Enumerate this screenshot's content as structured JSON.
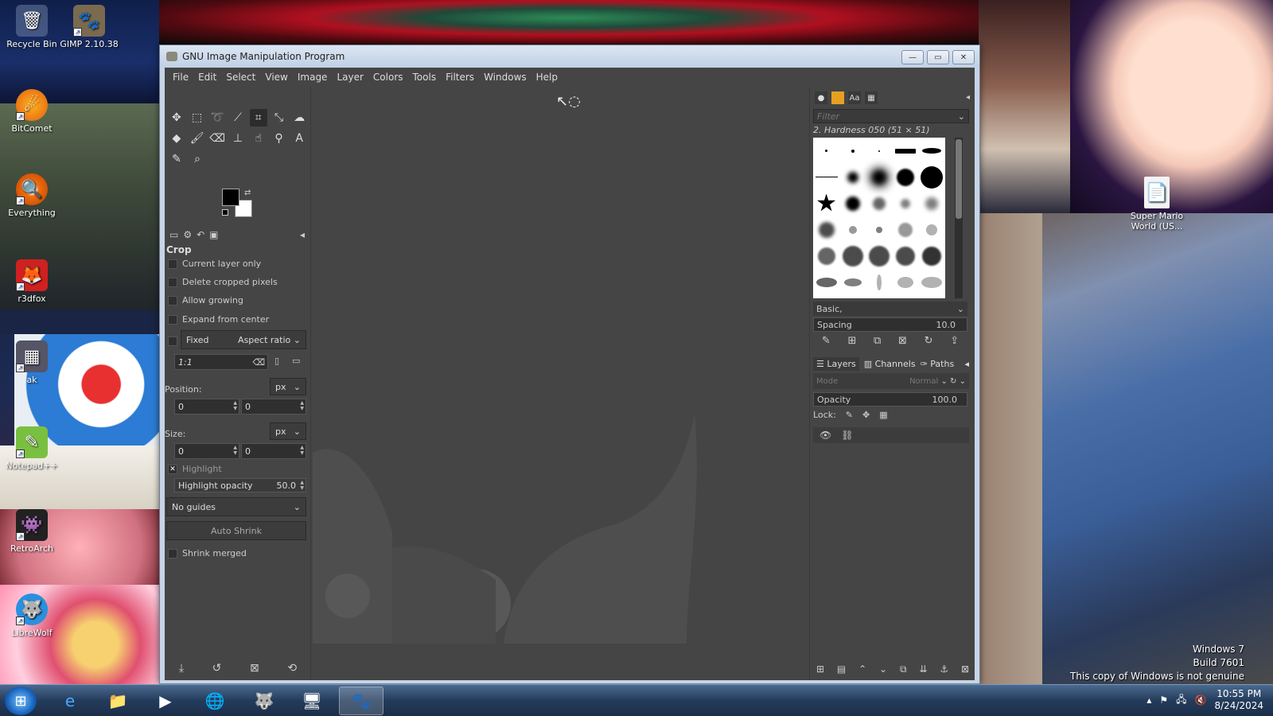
{
  "desktop": {
    "icons": [
      {
        "label": "Recycle Bin",
        "glyph": "🗑"
      },
      {
        "label": "GIMP 2.10.38",
        "glyph": "🐾"
      },
      {
        "label": "BitComet",
        "glyph": "☄"
      },
      {
        "label": "Everything",
        "glyph": "🔍"
      },
      {
        "label": "r3dfox",
        "glyph": "🦊"
      },
      {
        "label": "ak",
        "glyph": "▦"
      },
      {
        "label": "Notepad++",
        "glyph": "✎"
      },
      {
        "label": "RetroArch",
        "glyph": "👾"
      },
      {
        "label": "LibreWolf",
        "glyph": "🐺"
      },
      {
        "label": "Super Mario World (US...",
        "glyph": "📄"
      }
    ],
    "watermark": {
      "line1": "Windows 7",
      "line2": "Build 7601",
      "line3": "This copy of Windows is not genuine"
    }
  },
  "window": {
    "title": "GNU Image Manipulation Program",
    "controls": {
      "minimize": "—",
      "maximize": "▭",
      "close": "✕"
    }
  },
  "menubar": [
    "File",
    "Edit",
    "Select",
    "View",
    "Image",
    "Layer",
    "Colors",
    "Tools",
    "Filters",
    "Windows",
    "Help"
  ],
  "tool_options": {
    "title": "Crop",
    "current_layer_only": "Current layer only",
    "delete_cropped_pixels": "Delete cropped pixels",
    "allow_growing": "Allow growing",
    "expand_from_center": "Expand from center",
    "fixed_label": "Fixed",
    "fixed_mode": "Aspect ratio",
    "ratio_value": "1:1",
    "position_label": "Position:",
    "position_unit": "px",
    "position_x": "0",
    "position_y": "0",
    "size_label": "Size:",
    "size_unit": "px",
    "size_w": "0",
    "size_h": "0",
    "highlight_label": "Highlight",
    "highlight_opacity_label": "Highlight opacity",
    "highlight_opacity_value": "50.0",
    "guides": "No guides",
    "auto_shrink": "Auto Shrink",
    "shrink_merged": "Shrink merged"
  },
  "brushes": {
    "filter_placeholder": "Filter",
    "current_brush": "2. Hardness 050 (51 × 51)",
    "tag": "Basic,",
    "spacing_label": "Spacing",
    "spacing_value": "10.0"
  },
  "layers": {
    "tabs": [
      "Layers",
      "Channels",
      "Paths"
    ],
    "mode_label": "Mode",
    "mode_value": "Normal",
    "opacity_label": "Opacity",
    "opacity_value": "100.0",
    "lock_label": "Lock:"
  },
  "taskbar": {
    "time": "10:55 PM",
    "date": "8/24/2024"
  }
}
